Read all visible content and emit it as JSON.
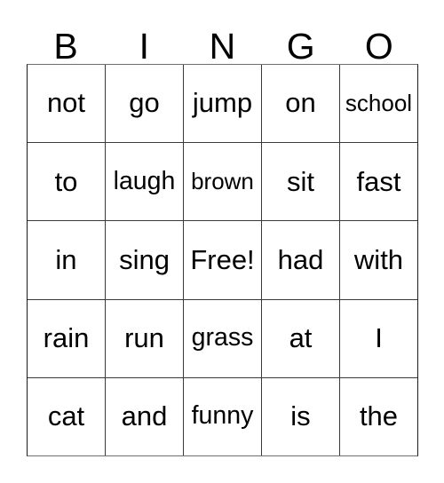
{
  "card": {
    "title_letters": [
      "B",
      "I",
      "N",
      "G",
      "O"
    ],
    "columns": 5,
    "rows": 5,
    "free_space_label": "Free!",
    "free_space_position": {
      "row": 3,
      "column": 3
    },
    "grid": [
      [
        {
          "text": "not",
          "size": "normal"
        },
        {
          "text": "go",
          "size": "normal"
        },
        {
          "text": "jump",
          "size": "normal"
        },
        {
          "text": "on",
          "size": "normal"
        },
        {
          "text": "school",
          "size": "small"
        }
      ],
      [
        {
          "text": "to",
          "size": "normal"
        },
        {
          "text": "laugh",
          "size": "tight"
        },
        {
          "text": "brown",
          "size": "small"
        },
        {
          "text": "sit",
          "size": "normal"
        },
        {
          "text": "fast",
          "size": "normal"
        }
      ],
      [
        {
          "text": "in",
          "size": "normal"
        },
        {
          "text": "sing",
          "size": "normal"
        },
        {
          "text": "Free!",
          "size": "normal"
        },
        {
          "text": "had",
          "size": "normal"
        },
        {
          "text": "with",
          "size": "normal"
        }
      ],
      [
        {
          "text": "rain",
          "size": "normal"
        },
        {
          "text": "run",
          "size": "normal"
        },
        {
          "text": "grass",
          "size": "tight"
        },
        {
          "text": "at",
          "size": "normal"
        },
        {
          "text": "I",
          "size": "normal"
        }
      ],
      [
        {
          "text": "cat",
          "size": "normal"
        },
        {
          "text": "and",
          "size": "normal"
        },
        {
          "text": "funny",
          "size": "tight"
        },
        {
          "text": "is",
          "size": "normal"
        },
        {
          "text": "the",
          "size": "normal"
        }
      ]
    ]
  },
  "colors": {
    "background": "#ffffff",
    "text": "#000000",
    "grid_line": "#3a3a3a",
    "outer_border": "#1a1a1a"
  }
}
